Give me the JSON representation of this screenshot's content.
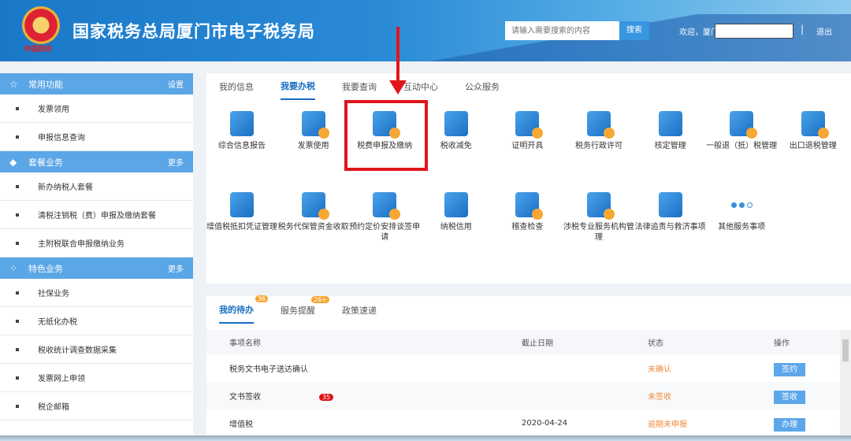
{
  "header": {
    "title": "国家税务总局厦门市电子税务局",
    "emblem_text": "中国税务",
    "search_placeholder": "请输入需要搜索的内容",
    "search_button": "搜索",
    "welcome": "欢迎，厦门",
    "separator": "|",
    "logout": "退出"
  },
  "sidebar": {
    "sections": [
      {
        "title": "常用功能",
        "action": "设置",
        "items": [
          "发票领用",
          "申报信息查询"
        ]
      },
      {
        "title": "套餐业务",
        "action": "更多",
        "items": [
          "新办纳税人套餐",
          "清税注销税（费）申报及缴纳套餐",
          "主附税联合申报缴纳业务"
        ]
      },
      {
        "title": "特色业务",
        "action": "更多",
        "items": [
          "社保业务",
          "无纸化办税",
          "税收统计调查数据采集",
          "发票网上申领",
          "税企邮箱"
        ]
      }
    ]
  },
  "main": {
    "tabs": [
      "我的信息",
      "我要办税",
      "我要查询",
      "互动中心",
      "公众服务"
    ],
    "active_tab": "我要办税",
    "services": [
      "综合信息报告",
      "发票使用",
      "税费申报及缴纳",
      "税收减免",
      "证明开具",
      "税务行政许可",
      "核定管理",
      "一般退（抵）税管理",
      "出口退税管理",
      "增值税抵扣凭证管理",
      "税务代保管资金收取",
      "预约定价安排谈签申请",
      "纳税信用",
      "稽查检查",
      "涉税专业服务机构管理",
      "法律追责与救济事项",
      "其他服务事项"
    ],
    "highlighted": "税费申报及缴纳",
    "highlight_color": "#e0161b"
  },
  "todo": {
    "tabs": [
      {
        "label": "我的待办",
        "badge": "36"
      },
      {
        "label": "服务提醒",
        "badge": "26+"
      },
      {
        "label": "政策速递",
        "badge": null
      }
    ],
    "columns": [
      "事项名称",
      "截止日期",
      "状态",
      "操作"
    ],
    "rows": [
      {
        "name": "税务文书电子送达确认",
        "badge": null,
        "date": "",
        "status": "未确认",
        "action": "签约"
      },
      {
        "name": "文书签收",
        "badge": "35",
        "date": "",
        "status": "未签收",
        "action": "签收"
      },
      {
        "name": "增值税",
        "badge": null,
        "date": "2020-04-24",
        "status": "逾期未申报",
        "action": "办理"
      }
    ]
  }
}
